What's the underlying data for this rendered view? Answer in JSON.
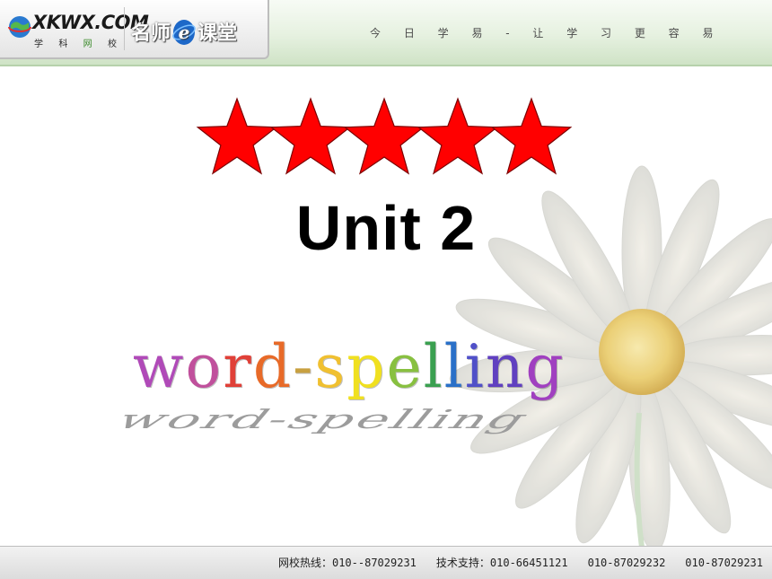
{
  "header": {
    "logo_text": "XKWX.COM",
    "logo_sub": [
      "学",
      "科",
      "网",
      "校"
    ],
    "brand_left": "名师",
    "brand_badge": "e",
    "brand_right": "课堂",
    "slogan": "今 日 学 易 - 让 学 习 更 容 易"
  },
  "slide": {
    "stars_count": 5,
    "star_color": "#ff0000",
    "title": "Unit 2",
    "wordart": "word-spelling",
    "wordart_letters": [
      "w",
      "o",
      "r",
      "d",
      "-",
      "s",
      "p",
      "e",
      "l",
      "l",
      "i",
      "n",
      "g"
    ],
    "wordart_colors": [
      "#b04ab8",
      "#c0509c",
      "#e04038",
      "#e86a28",
      "#c8a040",
      "#f0c030",
      "#f0e020",
      "#88c040",
      "#3aa050",
      "#2a70c8",
      "#5050c8",
      "#6040c0",
      "#a040c0"
    ]
  },
  "footer": {
    "hotline": "网校热线：010--87029231",
    "support": "技术支持：010-66451121",
    "phone2": "010-87029232",
    "phone3": "010-87029231"
  }
}
